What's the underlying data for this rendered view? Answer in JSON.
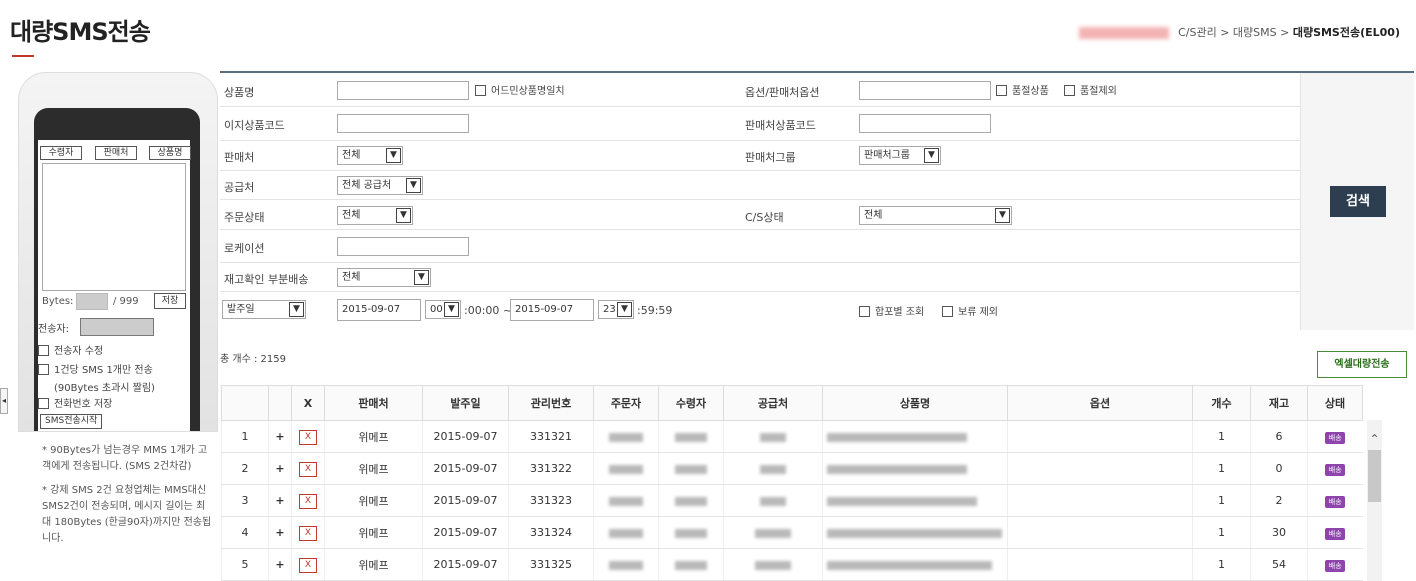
{
  "page": {
    "title": "대량SMS전송"
  },
  "breadcrumb": {
    "path": "C/S관리 > 대량SMS > ",
    "current": "대량SMS전송(EL00)"
  },
  "phone": {
    "buttons": [
      "수령자",
      "판매처",
      "상품명"
    ],
    "bytes_label": "Bytes:",
    "bytes_max": "/ 999",
    "save_label": "저장",
    "sender_label": "전송자:",
    "options": [
      "전송자 수정",
      "1건당 SMS 1개만 전송",
      "(90Bytes 초과시 짤림)",
      "전화번호 저장"
    ],
    "start_label": "SMS전송시작",
    "notes": [
      "* 90Bytes가 넘는경우 MMS 1개가 고객에게 전송됩니다. (SMS 2건차감)",
      "* 강제 SMS 2건 요청업체는 MMS대신 SMS2건이 전송되며, 메시지 길이는 최대 180Bytes (한글90자)까지만 전송됩니다."
    ]
  },
  "search": {
    "product_name": "상품명",
    "exact_match": "어드민상품명일치",
    "option_label": "옵션/판매처옵션",
    "sold_out": "품절상품",
    "exclude_sold_out": "품절제외",
    "easy_code": "이지상품코드",
    "seller_code": "판매처상품코드",
    "seller": "판매처",
    "seller_value": "전체",
    "seller_group": "판매처그룹",
    "seller_group_value": "판매처그룹",
    "supplier": "공급처",
    "supplier_value": "전체 공급처",
    "order_status": "주문상태",
    "order_status_value": "전체",
    "cs_status": "C/S상태",
    "cs_status_value": "전체",
    "location": "로케이션",
    "stock_partial": "재고확인 부분배송",
    "stock_partial_value": "전체",
    "date_type": "발주일",
    "date_from": "2015-09-07",
    "hour_from": "00",
    "time_from_rest": ":00:00 ~",
    "date_to": "2015-09-07",
    "hour_to": "23",
    "time_to_rest": ":59:59",
    "combined": "합포별 조회",
    "hold_exclude": "보류 제외",
    "search_label": "검색"
  },
  "total": "총 개수 : 2159",
  "excel_label": "엑셀대량전송",
  "table": {
    "headers": [
      "",
      "",
      "X",
      "판매처",
      "발주일",
      "관리번호",
      "주문자",
      "수령자",
      "공급처",
      "상품명",
      "옵션",
      "개수",
      "재고",
      "상태"
    ],
    "rows": [
      {
        "no": "1",
        "plus": "+",
        "x": "X",
        "seller": "위메프",
        "date": "2015-09-07",
        "id": "331321",
        "qty": "1",
        "stock": "6",
        "status": "배송"
      },
      {
        "no": "2",
        "plus": "+",
        "x": "X",
        "seller": "위메프",
        "date": "2015-09-07",
        "id": "331322",
        "qty": "1",
        "stock": "0",
        "status": "배송"
      },
      {
        "no": "3",
        "plus": "+",
        "x": "X",
        "seller": "위메프",
        "date": "2015-09-07",
        "id": "331323",
        "qty": "1",
        "stock": "2",
        "status": "배송"
      },
      {
        "no": "4",
        "plus": "+",
        "x": "X",
        "seller": "위메프",
        "date": "2015-09-07",
        "id": "331324",
        "qty": "1",
        "stock": "30",
        "status": "배송"
      },
      {
        "no": "5",
        "plus": "+",
        "x": "X",
        "seller": "위메프",
        "date": "2015-09-07",
        "id": "331325",
        "qty": "1",
        "stock": "54",
        "status": "배송"
      }
    ]
  }
}
